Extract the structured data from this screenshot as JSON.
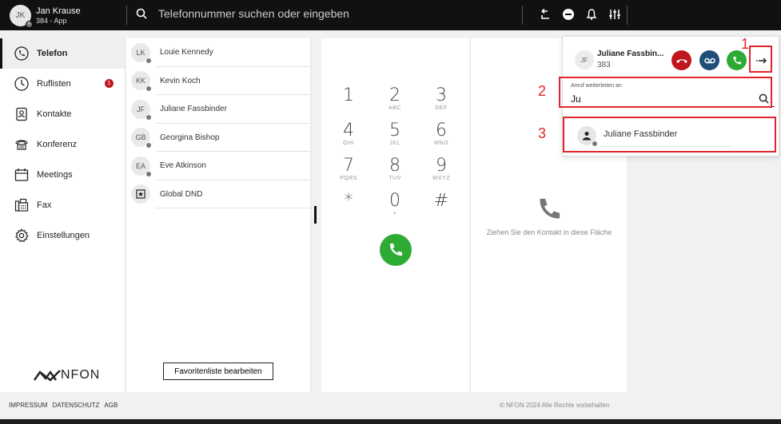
{
  "user": {
    "initials": "JK",
    "name": "Jan Krause",
    "sub": "384 - App"
  },
  "search": {
    "placeholder": "Telefonnummer suchen oder eingeben"
  },
  "sidebar": {
    "items": [
      {
        "label": "Telefon",
        "icon": "phone-icon"
      },
      {
        "label": "Ruflisten",
        "icon": "clock-icon",
        "badge": "1"
      },
      {
        "label": "Kontakte",
        "icon": "contact-icon"
      },
      {
        "label": "Konferenz",
        "icon": "conference-icon"
      },
      {
        "label": "Meetings",
        "icon": "calendar-icon"
      },
      {
        "label": "Fax",
        "icon": "fax-icon"
      },
      {
        "label": "Einstellungen",
        "icon": "settings-icon"
      }
    ],
    "logo": "NFON"
  },
  "favorites": {
    "items": [
      {
        "initials": "LK",
        "name": "Louie Kennedy"
      },
      {
        "initials": "KK",
        "name": "Kevin Koch"
      },
      {
        "initials": "JF",
        "name": "Juliane Fassbinder"
      },
      {
        "initials": "GB",
        "name": "Georgina Bishop"
      },
      {
        "initials": "EA",
        "name": "Eve Atkinson"
      },
      {
        "initials": "",
        "name": "Global DND"
      }
    ],
    "edit_label": "Favoritenliste bearbeiten"
  },
  "dialpad": {
    "keys": [
      {
        "d": "1",
        "l": ""
      },
      {
        "d": "2",
        "l": "ABC"
      },
      {
        "d": "3",
        "l": "DEF"
      },
      {
        "d": "4",
        "l": "GHI"
      },
      {
        "d": "5",
        "l": "JKL"
      },
      {
        "d": "6",
        "l": "MNO"
      },
      {
        "d": "7",
        "l": "PQRS"
      },
      {
        "d": "8",
        "l": "TUV"
      },
      {
        "d": "9",
        "l": "WXYZ"
      },
      {
        "d": "*",
        "l": ""
      },
      {
        "d": "0",
        "l": "+"
      },
      {
        "d": "#",
        "l": ""
      }
    ]
  },
  "dropzone": {
    "text": "Ziehen Sie den Kontakt in diese Fläche"
  },
  "popup": {
    "caller_initials": "JF",
    "caller_name": "Juliane Fassbin...",
    "caller_number": "383",
    "forward_label": "Anruf weiterleiten an",
    "forward_value": "Ju",
    "result_name": "Juliane Fassbinder",
    "markers": [
      "1",
      "2",
      "3"
    ]
  },
  "footer": {
    "links": [
      "IMPRESSUM",
      "DATENSCHUTZ",
      "AGB"
    ],
    "copyright": "© NFON 2024 Alle Rechte vorbehalten"
  },
  "colors": {
    "accent_red": "#e1252c",
    "call_green": "#2eab35",
    "hangup_red": "#c0161d",
    "voicemail_blue": "#1f4e79"
  }
}
